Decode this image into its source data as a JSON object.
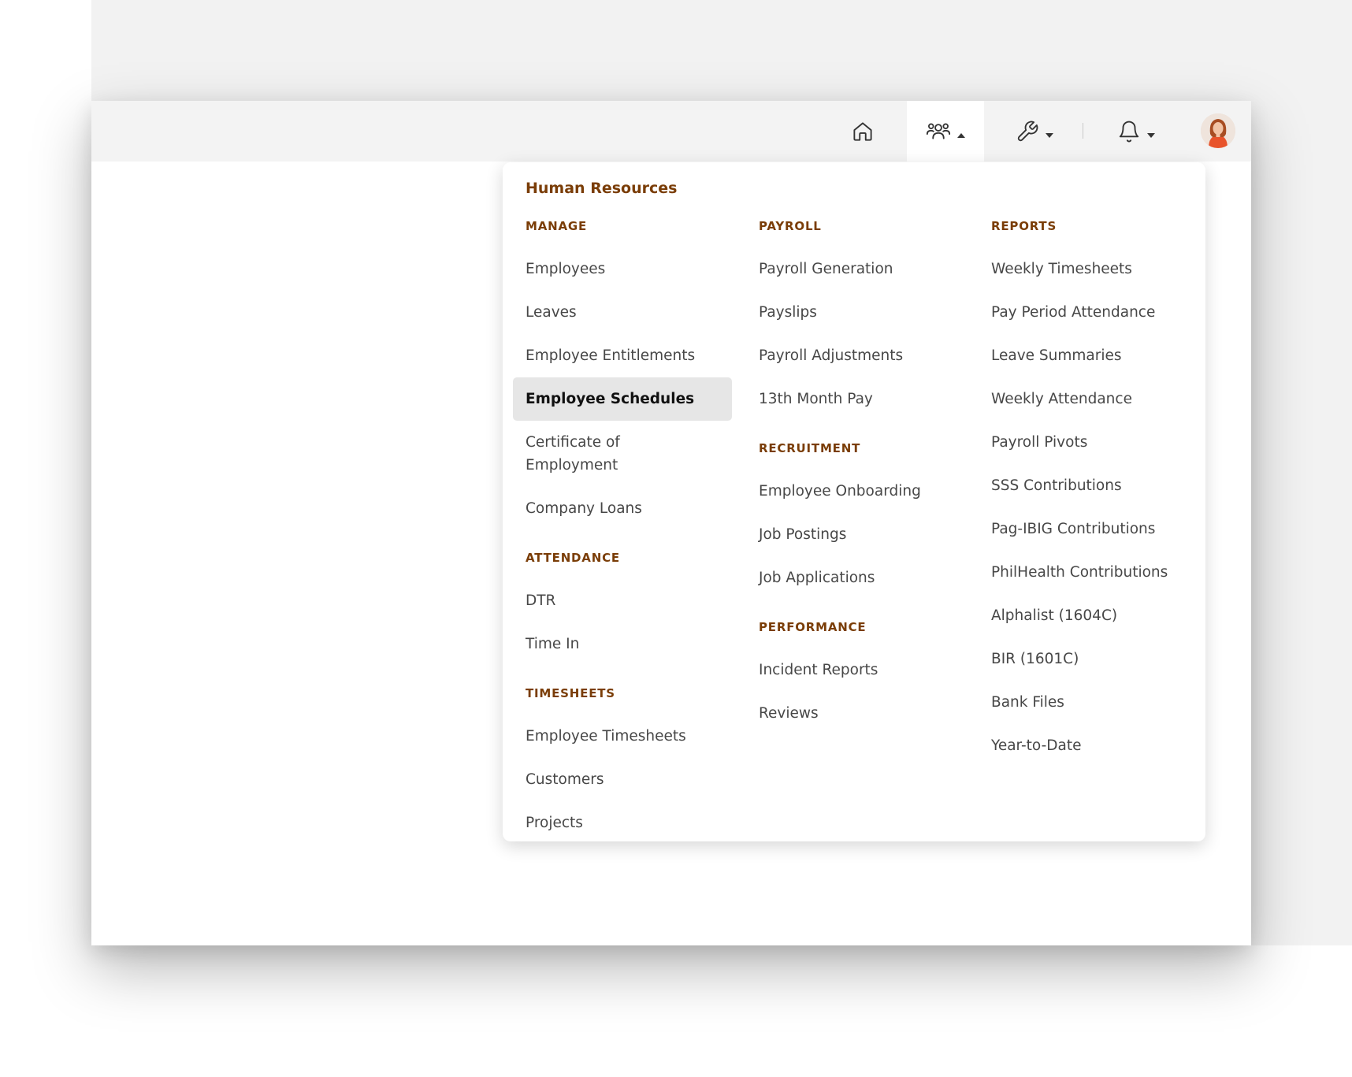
{
  "nav": {
    "home_icon": "home-icon",
    "hr_icon": "users-icon",
    "tools_icon": "wrench-icon",
    "bell_icon": "bell-icon",
    "active": "hr",
    "accent_color": "#7a3d07"
  },
  "menu": {
    "title": "Human Resources",
    "manage": {
      "label": "MANAGE",
      "items": [
        "Employees",
        "Leaves",
        "Employee Entitlements",
        "Employee Schedules",
        "Certificate of Employment",
        "Company Loans"
      ],
      "active": "Employee Schedules"
    },
    "attendance": {
      "label": "ATTENDANCE",
      "items": [
        "DTR",
        "Time In"
      ]
    },
    "timesheets": {
      "label": "TIMESHEETS",
      "items": [
        "Employee Timesheets",
        "Customers",
        "Projects"
      ]
    },
    "payroll": {
      "label": "PAYROLL",
      "items": [
        "Payroll Generation",
        "Payslips",
        "Payroll Adjustments",
        "13th Month Pay"
      ]
    },
    "recruitment": {
      "label": "RECRUITMENT",
      "items": [
        "Employee Onboarding",
        "Job Postings",
        "Job Applications"
      ]
    },
    "performance": {
      "label": "PERFORMANCE",
      "items": [
        "Incident Reports",
        "Reviews"
      ]
    },
    "reports": {
      "label": "REPORTS",
      "items": [
        "Weekly Timesheets",
        "Pay Period Attendance",
        "Leave Summaries",
        "Weekly Attendance",
        "Payroll Pivots",
        "SSS Contributions",
        "Pag-IBIG Contributions",
        "PhilHealth Contributions",
        "Alphalist (1604C)",
        "BIR (1601C)",
        "Bank Files",
        "Year-to-Date"
      ]
    }
  }
}
